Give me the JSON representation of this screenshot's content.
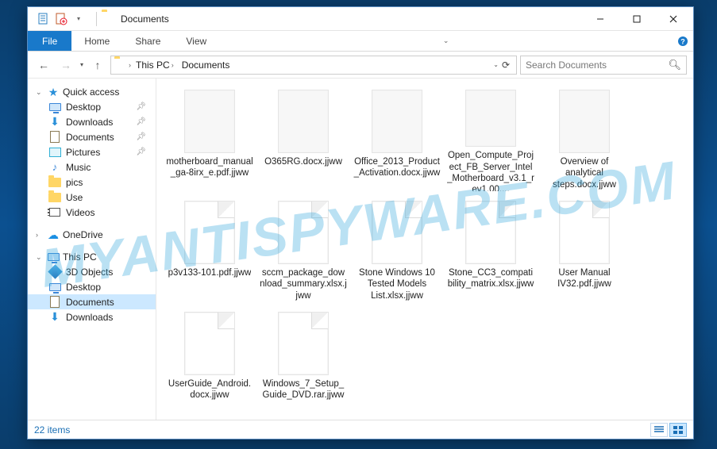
{
  "title": "Documents",
  "ribbon": {
    "file": "File",
    "tabs": [
      "Home",
      "Share",
      "View"
    ]
  },
  "breadcrumb": {
    "root": "This PC",
    "current": "Documents"
  },
  "search": {
    "placeholder": "Search Documents"
  },
  "sidebar": {
    "quick_access": {
      "label": "Quick access",
      "items": [
        {
          "label": "Desktop",
          "pinned": true,
          "icon": "desktop"
        },
        {
          "label": "Downloads",
          "pinned": true,
          "icon": "downloads"
        },
        {
          "label": "Documents",
          "pinned": true,
          "icon": "documents"
        },
        {
          "label": "Pictures",
          "pinned": true,
          "icon": "pictures"
        },
        {
          "label": "Music",
          "pinned": false,
          "icon": "music"
        },
        {
          "label": "pics",
          "pinned": false,
          "icon": "folder"
        },
        {
          "label": "Use",
          "pinned": false,
          "icon": "folder"
        },
        {
          "label": "Videos",
          "pinned": false,
          "icon": "videos"
        }
      ]
    },
    "onedrive": {
      "label": "OneDrive"
    },
    "this_pc": {
      "label": "This PC",
      "items": [
        {
          "label": "3D Objects",
          "icon": "3dobjects"
        },
        {
          "label": "Desktop",
          "icon": "desktop"
        },
        {
          "label": "Documents",
          "icon": "documents",
          "selected": true
        },
        {
          "label": "Downloads",
          "icon": "downloads"
        }
      ]
    }
  },
  "files": [
    {
      "name": "motherboard_manual_ga-8irx_e.pdf.jjww",
      "blank": false
    },
    {
      "name": "O365RG.docx.jjww",
      "blank": false
    },
    {
      "name": "Office_2013_Product_Activation.docx.jjww",
      "blank": false
    },
    {
      "name": "Open_Compute_Project_FB_Server_Intel_Motherboard_v3.1_rev1.00....",
      "blank": false
    },
    {
      "name": "Overview of analytical steps.docx.jjww",
      "blank": false
    },
    {
      "name": "p3v133-101.pdf.jjww",
      "blank": true
    },
    {
      "name": "sccm_package_download_summary.xlsx.jjww",
      "blank": true
    },
    {
      "name": "Stone Windows 10 Tested Models List.xlsx.jjww",
      "blank": true
    },
    {
      "name": "Stone_CC3_compatibility_matrix.xlsx.jjww",
      "blank": true
    },
    {
      "name": "User Manual IV32.pdf.jjww",
      "blank": true
    },
    {
      "name": "UserGuide_Android.docx.jjww",
      "blank": true
    },
    {
      "name": "Windows_7_Setup_Guide_DVD.rar.jjww",
      "blank": true
    }
  ],
  "status": {
    "count_label": "22 items"
  }
}
